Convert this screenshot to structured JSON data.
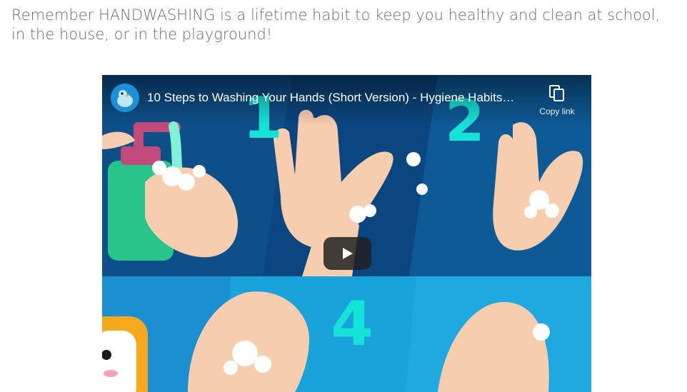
{
  "intro": {
    "text": "Remember HANDWASHING is a lifetime habit to keep you healthy and clean at school, in the house, or in the playground!"
  },
  "video": {
    "title": "10 Steps to Washing Your Hands (Short Version) - Hygiene Habits…",
    "copy_link_label": "Copy link",
    "step_numbers": [
      "1",
      "2",
      "4"
    ],
    "icons": {
      "avatar": "channel-avatar-icon",
      "copy": "copy-icon",
      "play": "play-icon"
    },
    "colors": {
      "panel_dark": "#0d5a96",
      "panel_light": "#1aa3db",
      "step_number": "#16e3d8",
      "skin": "#f7cdb0",
      "soap_bottle": "#28c48a",
      "soap_pump": "#c24a7a"
    }
  }
}
